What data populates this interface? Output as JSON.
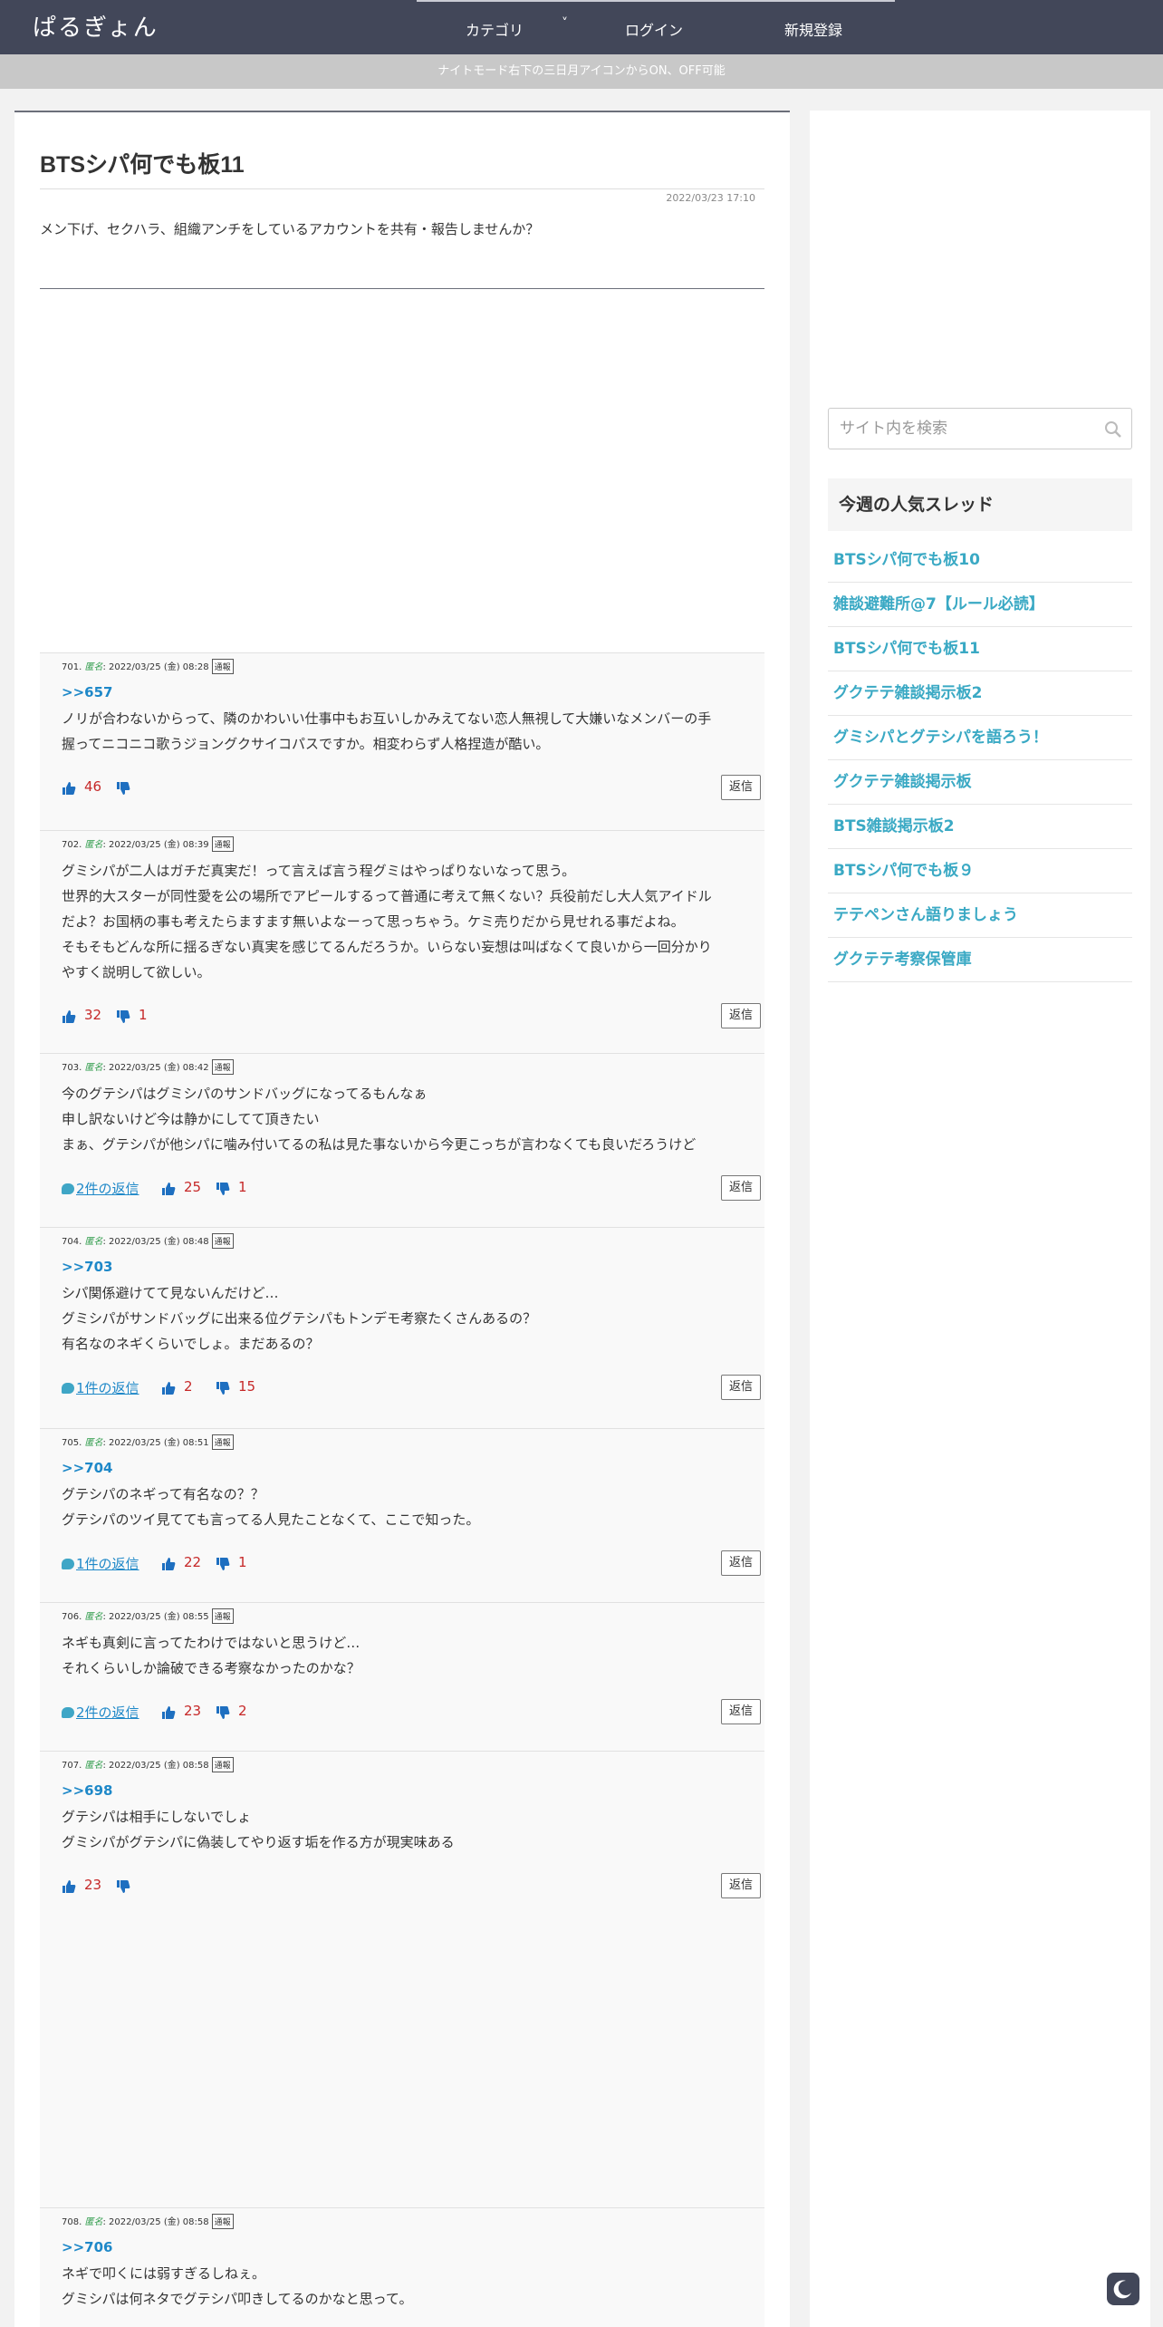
{
  "header": {
    "logo": "ぱるぎょん",
    "nav": [
      "カテゴリ",
      "ログイン",
      "新規登録"
    ],
    "caret": "˅"
  },
  "notice": "ナイトモード右下の三日月アイコンからON、OFF可能",
  "thread": {
    "title": "BTSシパ何でも板11",
    "date": "2022/03/23 17:10",
    "description": "メン下げ、セクハラ、組織アンチをしているアカウントを共有・報告しませんか？"
  },
  "labels": {
    "anonymous": "匿名",
    "report": "通報",
    "reply": "返信"
  },
  "comments": [
    {
      "meta": "701.",
      "time": ": 2022/03/25 (金) 08:28",
      "anchor": ">>657",
      "lines": [
        "ノリが合わないからって、隣のかわいい仕事中もお互いしかみえてない恋人無視して大嫌いなメンバーの手",
        "握ってニコニコ歌うジョングクサイコパスですか。相変わらず人格捏造が酷い。"
      ],
      "replies": "",
      "up": "46",
      "down": ""
    },
    {
      "meta": "702.",
      "time": ": 2022/03/25 (金) 08:39",
      "anchor": "",
      "lines": [
        "グミシパが二人はガチだ真実だ！って言えば言う程グミはやっぱりないなって思う。",
        "世界的大スターが同性愛を公の場所でアピールするって普通に考えて無くない？兵役前だし大人気アイドル",
        "だよ？お国柄の事も考えたらますます無いよなーって思っちゃう。ケミ売りだから見せれる事だよね。",
        "そもそもどんな所に揺るぎない真実を感じてるんだろうか。いらない妄想は叫ばなくて良いから一回分かり",
        "やすく説明して欲しい。"
      ],
      "replies": "",
      "up": "32",
      "down": "1"
    },
    {
      "meta": "703.",
      "time": ": 2022/03/25 (金) 08:42",
      "anchor": "",
      "lines": [
        "今のグテシパはグミシパのサンドバッグになってるもんなぁ",
        "申し訳ないけど今は静かにしてて頂きたい",
        "まぁ、グテシパが他シパに噛み付いてるの私は見た事ないから今更こっちが言わなくても良いだろうけど"
      ],
      "replies": "2件の返信",
      "up": "25",
      "down": "1"
    },
    {
      "meta": "704.",
      "time": ": 2022/03/25 (金) 08:48",
      "anchor": ">>703",
      "lines": [
        "シパ関係避けてて見ないんだけど…",
        "グミシパがサンドバッグに出来る位グテシパもトンデモ考察たくさんあるの？",
        "有名なのネギくらいでしょ。まだあるの？"
      ],
      "replies": "1件の返信",
      "up": "2",
      "down": "15"
    },
    {
      "meta": "705.",
      "time": ": 2022/03/25 (金) 08:51",
      "anchor": ">>704",
      "lines": [
        "グテシパのネギって有名なの？？",
        "グテシパのツイ見てても言ってる人見たことなくて、ここで知った。"
      ],
      "replies": "1件の返信",
      "up": "22",
      "down": "1"
    },
    {
      "meta": "706.",
      "time": ": 2022/03/25 (金) 08:55",
      "anchor": "",
      "lines": [
        "ネギも真剣に言ってたわけではないと思うけど…",
        "それくらいしか論破できる考察なかったのかな？"
      ],
      "replies": "2件の返信",
      "up": "23",
      "down": "2"
    },
    {
      "meta": "707.",
      "time": ": 2022/03/25 (金) 08:58",
      "anchor": ">>698",
      "lines": [
        "グテシパは相手にしないでしょ",
        "グミシパがグテシパに偽装してやり返す垢を作る方が現実味ある"
      ],
      "replies": "",
      "up": "23",
      "down": ""
    },
    {
      "meta": "708.",
      "time": ": 2022/03/25 (金) 08:58",
      "anchor": ">>706",
      "lines": [
        "ネギで叩くには弱すぎるしねぇ。",
        "グミシパは何ネタでグテシパ叩きしてるのかなと思って。"
      ],
      "replies": "",
      "up": "",
      "down": ""
    }
  ],
  "sidebar": {
    "search_placeholder": "サイト内を検索",
    "widget_title": "今週の人気スレッド",
    "items": [
      "BTSシパ何でも板10",
      "雑談避難所@7【ルール必読】",
      "BTSシパ何でも板11",
      "グクテテ雑談掲示板2",
      "グミシパとグテシパを語ろう！",
      "グクテテ雑談掲示板",
      "BTS雑談掲示板2",
      "BTSシパ何でも板９",
      "テテペンさん語りましょう",
      "グクテテ考察保管庫"
    ]
  },
  "colors": {
    "header": "#424759",
    "link": "#1e88c8",
    "sidebar_link": "#3aa9c4",
    "count": "#c62828"
  }
}
